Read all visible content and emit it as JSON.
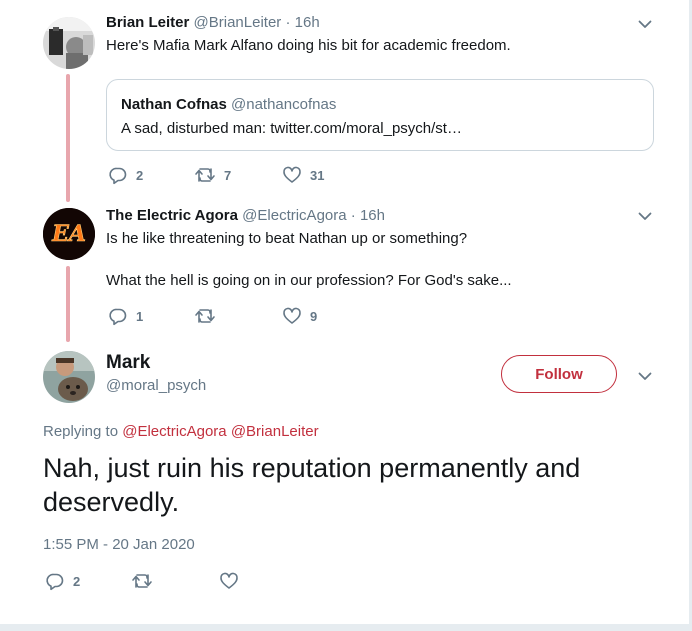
{
  "tweets": [
    {
      "name": "Brian Leiter",
      "handle": "@BrianLeiter",
      "separator": "·",
      "time": "16h",
      "text": "Here's Mafia Mark Alfano doing his bit for academic freedom.",
      "quote": {
        "name": "Nathan Cofnas",
        "handle": "@nathancofnas",
        "text": "A sad, disturbed man: twitter.com/moral_psych/st…"
      },
      "replies": "2",
      "retweets": "7",
      "likes": "31"
    },
    {
      "name": "The Electric Agora",
      "handle": "@ElectricAgora",
      "separator": "·",
      "time": "16h",
      "avatar_text": "EA",
      "text_line1": "Is he like threatening to beat Nathan up or something?",
      "text_line2": "What the hell is going on in our profession?  For God's sake...",
      "replies": "1",
      "retweets": "",
      "likes": "9"
    }
  ],
  "main": {
    "name": "Mark",
    "handle": "@moral_psych",
    "follow_label": "Follow",
    "replying_prefix": "Replying to",
    "replying_to": [
      "@ElectricAgora",
      "@BrianLeiter"
    ],
    "text": "Nah, just ruin his reputation permanently and deservedly.",
    "timestamp": "1:55 PM - 20 Jan 2020",
    "replies": "2",
    "retweets": "",
    "likes": ""
  },
  "colors": {
    "accent": "#c2303e",
    "thread_line": "#e8a6ad",
    "muted": "#657786",
    "text": "#14171a"
  },
  "icons": [
    "chevron-down-icon",
    "reply-icon",
    "retweet-icon",
    "like-icon"
  ]
}
